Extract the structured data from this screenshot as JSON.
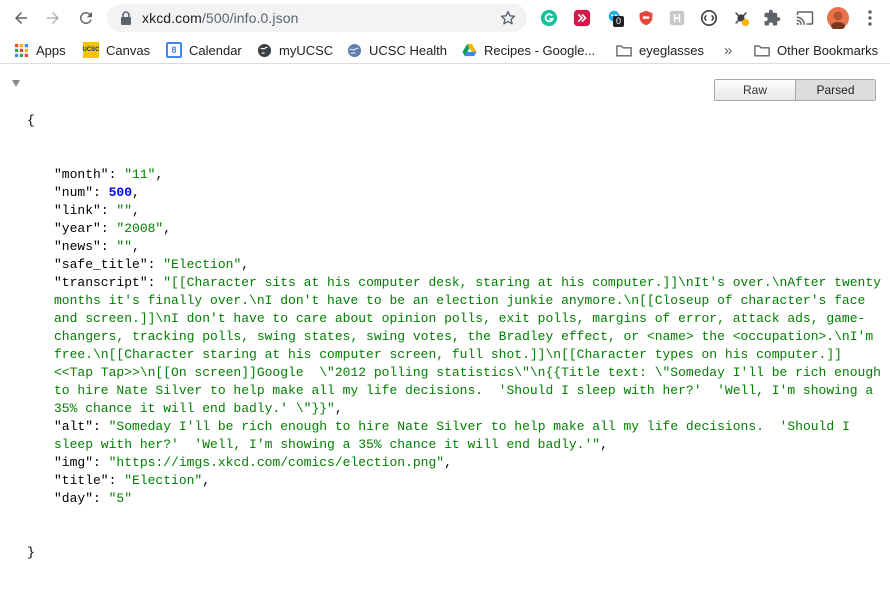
{
  "browser": {
    "url_host": "xkcd.com",
    "url_path": "/500/info.0.json",
    "extensions": [
      "grammarly-icon",
      "pocket-icon",
      "extension-badge-icon",
      "shield-extension-icon",
      "hackerank-icon",
      "circle-extension-icon",
      "checker-extension-icon",
      "puzzle-icon",
      "cast-icon",
      "profile-avatar",
      "menu-icon"
    ],
    "extension_badge": "0"
  },
  "bookmarks": {
    "apps": "Apps",
    "canvas": "Canvas",
    "calendar": "Calendar",
    "calendar_day": "8",
    "myucsc": "myUCSC",
    "ucsc_health": "UCSC Health",
    "recipes": "Recipes - Google...",
    "eyeglasses": "eyeglasses",
    "more": "»",
    "other": "Other Bookmarks",
    "ucsc_logo_text": "UCSC"
  },
  "viewer": {
    "raw_label": "Raw",
    "parsed_label": "Parsed",
    "active": "Parsed"
  },
  "json": {
    "open_brace": "{",
    "close_brace": "}",
    "entries": [
      {
        "key": "\"month\"",
        "value": "\"11\"",
        "type": "string",
        "comma": ","
      },
      {
        "key": "\"num\"",
        "value": "500",
        "type": "number",
        "comma": ","
      },
      {
        "key": "\"link\"",
        "value": "\"\"",
        "type": "string",
        "comma": ","
      },
      {
        "key": "\"year\"",
        "value": "\"2008\"",
        "type": "string",
        "comma": ","
      },
      {
        "key": "\"news\"",
        "value": "\"\"",
        "type": "string",
        "comma": ","
      },
      {
        "key": "\"safe_title\"",
        "value": "\"Election\"",
        "type": "string",
        "comma": ","
      },
      {
        "key": "\"transcript\"",
        "value": "\"[[Character sits at his computer desk, staring at his computer.]]\\nIt's over.\\nAfter twenty months it's finally over.\\nI don't have to be an election junkie anymore.\\n[[Closeup of character's face and screen.]]\\nI don't have to care about opinion polls, exit polls, margins of error, attack ads, game-changers, tracking polls, swing states, swing votes, the Bradley effect, or <name> the <occupation>.\\nI'm free.\\n[[Character staring at his computer screen, full shot.]]\\n[[Character types on his computer.]] <<Tap Tap>>\\n[[On screen]]Google  \\\"2012 polling statistics\\\"\\n{{Title text: \\\"Someday I'll be rich enough to hire Nate Silver to help make all my life decisions.  'Should I sleep with her?'  'Well, I'm showing a 35% chance it will end badly.' \\\"}}\"",
        "type": "string",
        "comma": ","
      },
      {
        "key": "\"alt\"",
        "value": "\"Someday I'll be rich enough to hire Nate Silver to help make all my life decisions.  'Should I sleep with her?'  'Well, I'm showing a 35% chance it will end badly.'\"",
        "type": "string",
        "comma": ","
      },
      {
        "key": "\"img\"",
        "value": "\"https://imgs.xkcd.com/comics/election.png\"",
        "type": "string",
        "comma": ","
      },
      {
        "key": "\"title\"",
        "value": "\"Election\"",
        "type": "string",
        "comma": ","
      },
      {
        "key": "\"day\"",
        "value": "\"5\"",
        "type": "string",
        "comma": ""
      }
    ]
  },
  "colors": {
    "string": "#008000",
    "number": "#0000ff",
    "omnibox_bg": "#f1f3f4"
  }
}
